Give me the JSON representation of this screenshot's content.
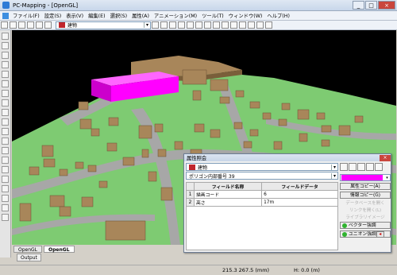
{
  "window": {
    "title": "PC-Mapping - [OpenGL]",
    "controls": [
      "_",
      "□",
      "×"
    ]
  },
  "menu": [
    "ファイル(F)",
    "設定(S)",
    "表示(V)",
    "編集(E)",
    "選択(S)",
    "属性(A)",
    "アニメーション(M)",
    "ツール(T)",
    "ウィンドウ(W)",
    "ヘルプ(H)"
  ],
  "toolbar": {
    "layer_name": "建物"
  },
  "view_tabs": [
    "OpenGL",
    "OpenGL"
  ],
  "output_tab": "Output",
  "status": {
    "coords": "215.3  267.5 (mm)",
    "height": "H: 0.0 (m)"
  },
  "dialog": {
    "title": "属性照会",
    "layer": "建物",
    "polygon": "ポリゴン内部番号 39",
    "table": {
      "headers": [
        "",
        "フィールド名称",
        "フィールドデータ"
      ],
      "rows": [
        [
          "1",
          "描画コード",
          "6"
        ],
        [
          "2",
          "高さ",
          "17m"
        ]
      ]
    },
    "buttons": {
      "attribute_copy": "属性コピー(A)",
      "info_copy": "情報コピー(G)",
      "data_link": "データベースを開く",
      "layer_link": "リンクを開く(L)",
      "image_link": "ライブラリイメージ",
      "vector_emphasis": "ベクター強調",
      "union_emphasis": "ユニオン強調"
    }
  },
  "colors": {
    "ground": "#7ecb72",
    "road": "#a7a7a7",
    "building": "#a8865a",
    "highlight": "#ff00ff",
    "sky": "#000000"
  }
}
